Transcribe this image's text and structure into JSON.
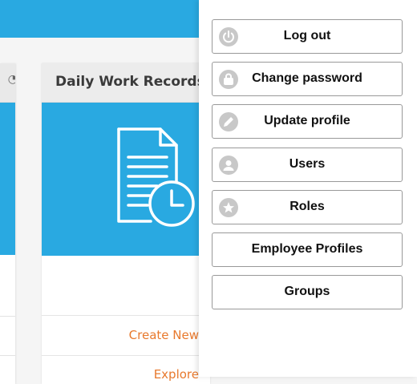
{
  "card": {
    "title": "Daily Work Records",
    "create_label": "Create New",
    "explore_label": "Explore"
  },
  "menu": {
    "items": [
      {
        "label": "Log out",
        "icon": "power-icon"
      },
      {
        "label": "Change password",
        "icon": "lock-icon"
      },
      {
        "label": "Update profile",
        "icon": "pencil-icon"
      },
      {
        "label": "Users",
        "icon": "user-icon"
      },
      {
        "label": "Roles",
        "icon": "star-icon"
      },
      {
        "label": "Employee Profiles",
        "icon": ""
      },
      {
        "label": "Groups",
        "icon": ""
      }
    ]
  },
  "colors": {
    "header_blue": "#29a9e1",
    "action_orange": "#e8792d"
  }
}
